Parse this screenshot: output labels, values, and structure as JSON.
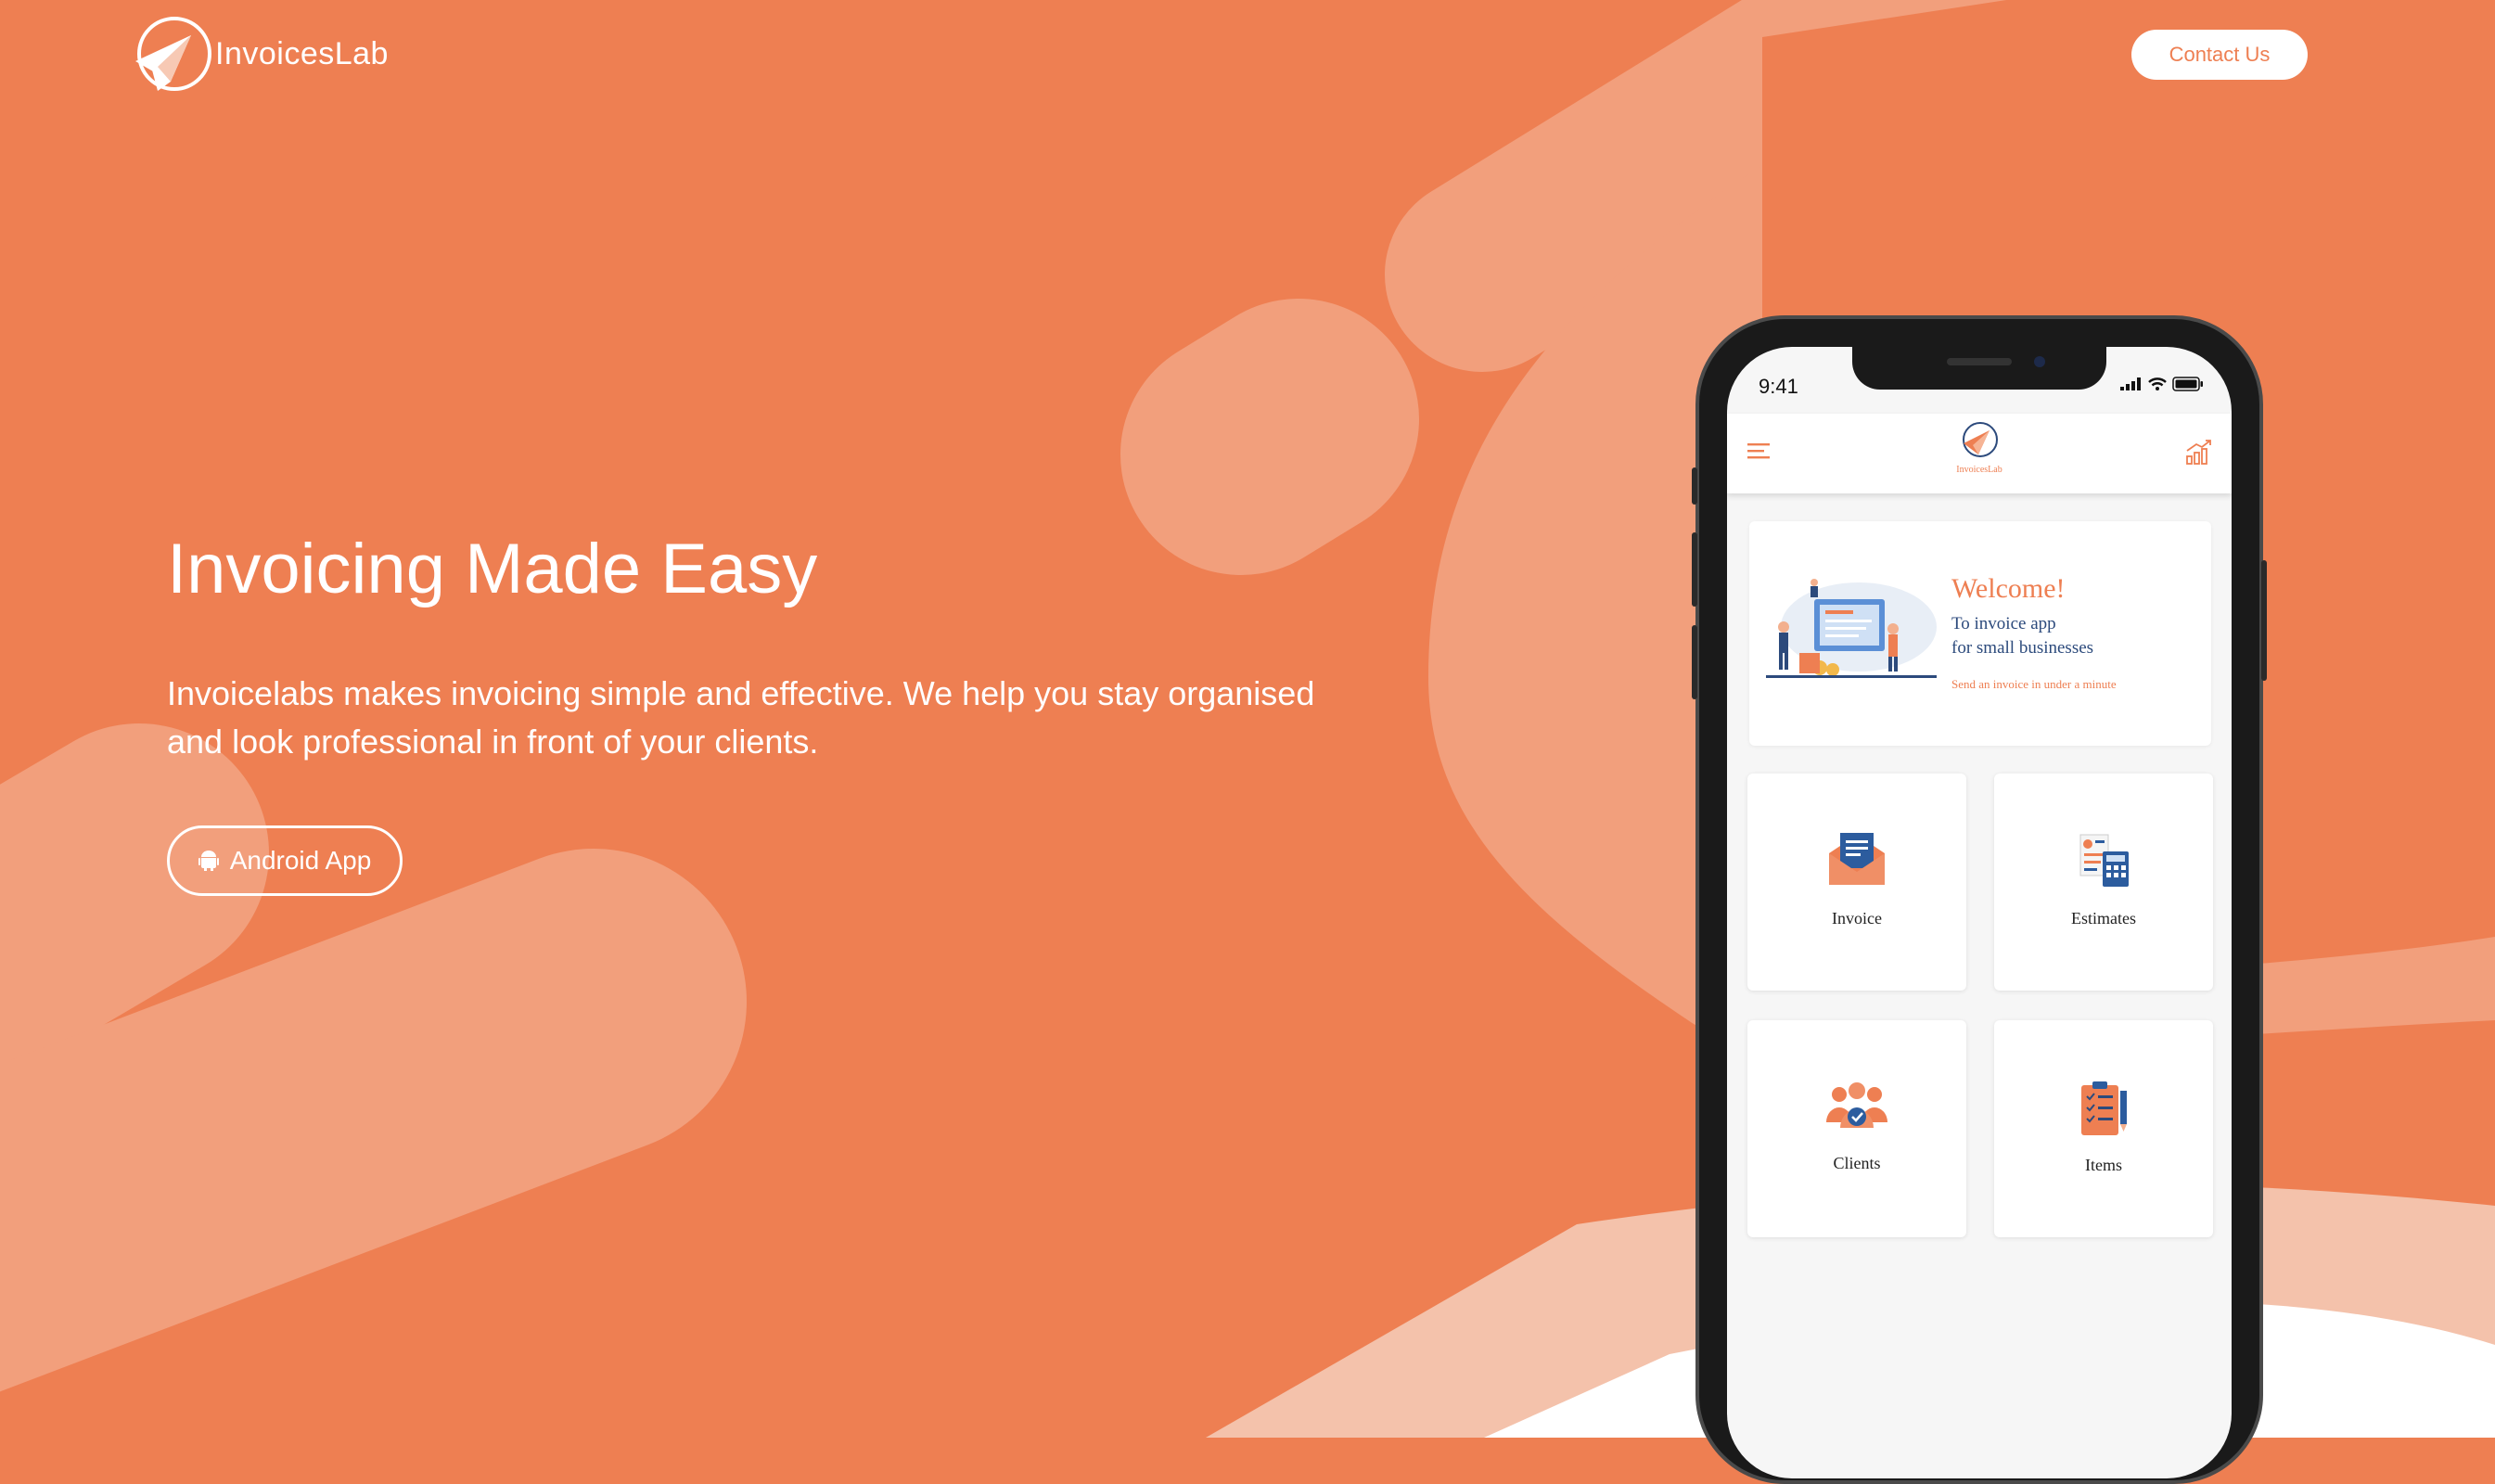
{
  "brand": {
    "name": "InvoicesLab",
    "color": "#EE7F52"
  },
  "header": {
    "contact_label": "Contact Us"
  },
  "hero": {
    "title": "Invoicing Made Easy",
    "subtitle": "Invoicelabs makes invoicing simple and effective. We help you stay organised and look professional in front of your clients.",
    "android_button": "Android App"
  },
  "phone": {
    "status_time": "9:41",
    "app_logo_text": "InvoicesLab",
    "welcome": {
      "title": "Welcome!",
      "line1": "To invoice app",
      "line2": "for small businesses",
      "note": "Send an invoice in under a minute"
    },
    "tiles": [
      {
        "label": "Invoice",
        "icon": "invoice-icon"
      },
      {
        "label": "Estimates",
        "icon": "estimates-icon"
      },
      {
        "label": "Clients",
        "icon": "clients-icon"
      },
      {
        "label": "Items",
        "icon": "items-icon"
      }
    ]
  }
}
